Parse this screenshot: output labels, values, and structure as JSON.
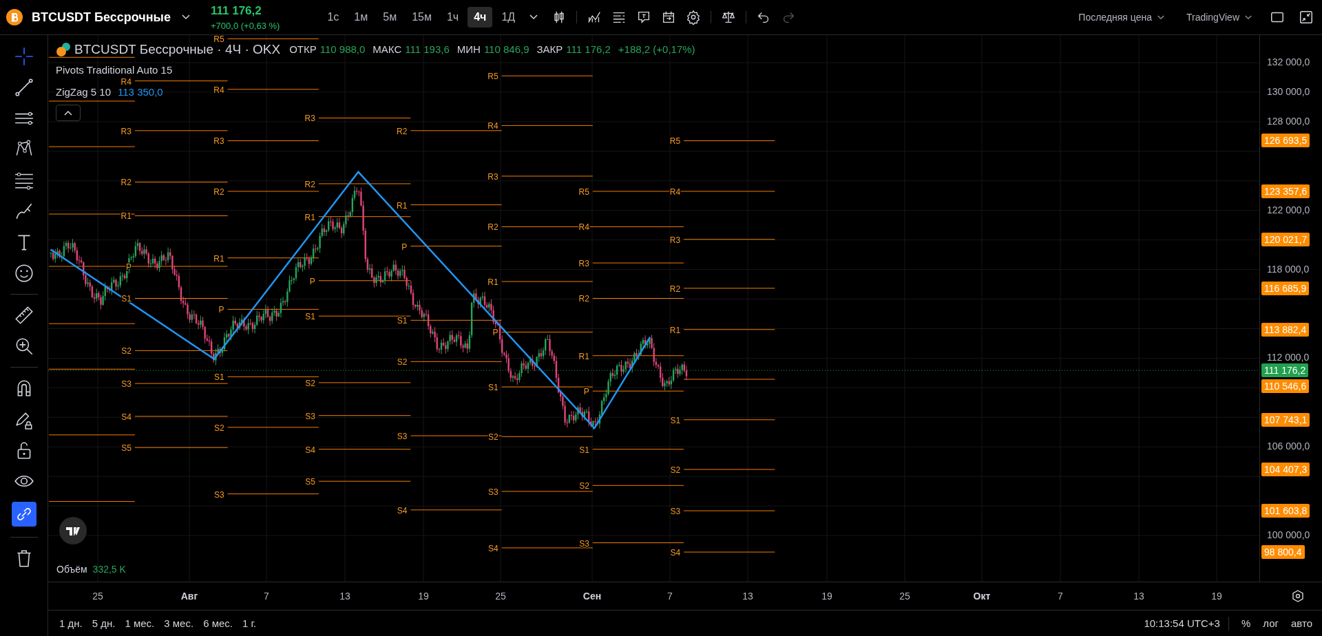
{
  "header": {
    "symbol": "BTCUSDT Бессрочные",
    "price": "111 176,2",
    "change": "+700,0 (+0,63 %)",
    "intervals": [
      {
        "label": "1с",
        "selected": false
      },
      {
        "label": "1м",
        "selected": false
      },
      {
        "label": "5м",
        "selected": false
      },
      {
        "label": "15м",
        "selected": false
      },
      {
        "label": "1ч",
        "selected": false
      },
      {
        "label": "4ч",
        "selected": true
      },
      {
        "label": "1Д",
        "selected": false
      }
    ],
    "price_source": "Последняя цена",
    "theme": "TradingView"
  },
  "legend": {
    "title": "BTCUSDT Бессрочные · 4Ч · OKX",
    "ohlc": [
      {
        "label": "ОТКР",
        "value": "110 988,0"
      },
      {
        "label": "МАКС",
        "value": "111 193,6"
      },
      {
        "label": "МИН",
        "value": "110 846,9"
      },
      {
        "label": "ЗАКР",
        "value": "111 176,2"
      }
    ],
    "change": "+188,2 (+0,17%)",
    "indicators": [
      {
        "name": "Pivots Traditional Auto 15"
      },
      {
        "name": "ZigZag 5 10",
        "value": "113 350,0"
      }
    ]
  },
  "pivot_periods": [
    {
      "levels": [
        "R4",
        "R3",
        "R2",
        "R1",
        "P",
        "S1",
        "S2",
        "S3",
        "S4",
        "S5"
      ]
    },
    {
      "levels": [
        "R5",
        "R4",
        "R3",
        "R2",
        "R1",
        "P",
        "S1",
        "S2",
        "S3"
      ]
    },
    {
      "levels": [
        "R3",
        "R2",
        "R1",
        "P",
        "S1",
        "S2",
        "S3",
        "S4",
        "S5"
      ]
    },
    {
      "levels": [
        "R2",
        "R1",
        "P",
        "S1",
        "S2",
        "S3",
        "S4"
      ]
    },
    {
      "levels": [
        "R5",
        "R4",
        "R3",
        "R2",
        "R1",
        "P",
        "S1",
        "S2",
        "S3",
        "S4"
      ]
    },
    {
      "levels": [
        "R5",
        "R4",
        "R3",
        "R2",
        "R1",
        "P",
        "S1",
        "S2",
        "S3"
      ]
    },
    {
      "levels": [
        "R5",
        "R4",
        "R3",
        "R2",
        "R1",
        "S1",
        "S2",
        "S3",
        "S4"
      ]
    }
  ],
  "price_axis": {
    "ticks": [
      "132 000,0",
      "130 000,0",
      "128 000,0",
      "122 000,0",
      "118 000,0",
      "112 000,0",
      "106 000,0",
      "100 000,0"
    ],
    "level_badges": [
      "126 693,5",
      "123 357,6",
      "120 021,7",
      "116 685,9",
      "113 882,4",
      "110 546,6",
      "107 743,1",
      "104 407,3",
      "101 603,8",
      "98 800,4"
    ],
    "last_price": "111 176,2"
  },
  "volume": {
    "label": "Объём",
    "value": "332,5 K"
  },
  "time_axis": [
    {
      "label": "25",
      "kind": "day"
    },
    {
      "label": "Авг",
      "kind": "month"
    },
    {
      "label": "7",
      "kind": "day"
    },
    {
      "label": "13",
      "kind": "day"
    },
    {
      "label": "19",
      "kind": "day"
    },
    {
      "label": "25",
      "kind": "day"
    },
    {
      "label": "Сен",
      "kind": "month"
    },
    {
      "label": "7",
      "kind": "day"
    },
    {
      "label": "13",
      "kind": "day"
    },
    {
      "label": "19",
      "kind": "day"
    },
    {
      "label": "25",
      "kind": "day"
    },
    {
      "label": "Окт",
      "kind": "month"
    },
    {
      "label": "7",
      "kind": "day"
    },
    {
      "label": "13",
      "kind": "day"
    },
    {
      "label": "19",
      "kind": "day"
    }
  ],
  "ranges": [
    "1 дн.",
    "5 дн.",
    "1 мес.",
    "3 мес.",
    "6 мес.",
    "1 г."
  ],
  "clock": "10:13:54 UTC+3",
  "scale_buttons": [
    "%",
    "лог",
    "авто"
  ]
}
